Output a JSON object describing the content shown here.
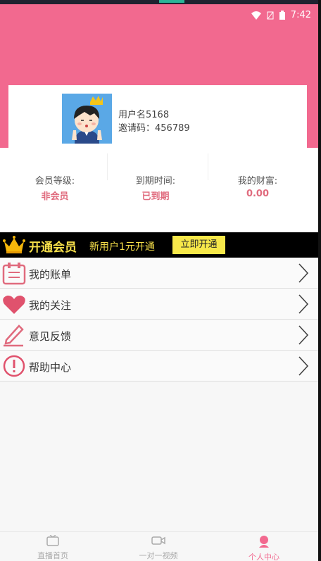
{
  "status": {
    "time": "7:42"
  },
  "profile": {
    "username": "用户名5168",
    "invite_code": "邀请码：456789"
  },
  "stats": [
    {
      "label": "会员等级:",
      "value": "非会员"
    },
    {
      "label": "到期时间:",
      "value": "已到期"
    },
    {
      "label": "我的财富:",
      "value": "0.00"
    }
  ],
  "vip": {
    "title": "开通会员",
    "subtitle": "新用户1元开通",
    "button": "立即开通"
  },
  "menu": [
    {
      "label": "我的账单",
      "icon": "bill-icon"
    },
    {
      "label": "我的关注",
      "icon": "heart-icon"
    },
    {
      "label": "意见反馈",
      "icon": "pen-icon"
    },
    {
      "label": "帮助中心",
      "icon": "help-icon"
    }
  ],
  "tabs": [
    {
      "label": "直播首页",
      "icon": "tv-icon"
    },
    {
      "label": "一对一视频",
      "icon": "video-icon"
    },
    {
      "label": "个人中心",
      "icon": "person-icon"
    }
  ],
  "colors": {
    "header": "#f2698f",
    "accent": "#e06b7e",
    "vip_yellow": "#f7e04a"
  }
}
